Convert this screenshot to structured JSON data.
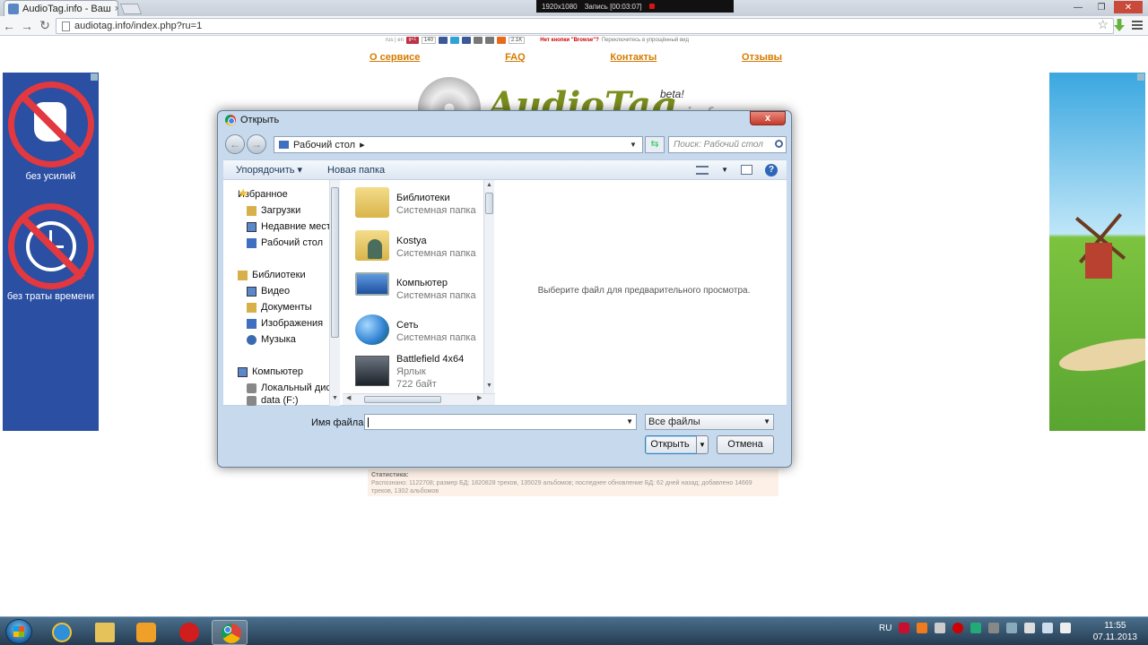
{
  "browser": {
    "tab_title": "AudioTag.info - Ваш",
    "tab_close": "×",
    "url": "audiotag.info/index.php?ru=1",
    "recorder": {
      "resolution": "1920x1080",
      "status": "Запись [00:03:07]"
    }
  },
  "page": {
    "share": {
      "langs": "rus | en",
      "gplus": "g+1",
      "gplus_count": "140",
      "total_count": "2.1K"
    },
    "notice_bold": "Нет кнопки \"Browse\"?",
    "notice_text": "Переключитесь в упрощённый вид",
    "nav": [
      "О сервисе",
      "FAQ",
      "Контакты",
      "Отзывы"
    ],
    "logo": {
      "word": "AudioTag",
      "beta": "beta!",
      "info": ".info"
    },
    "stats_title": "Статистика:",
    "stats_text": "Распознано: 1122708; размер БД: 1820828 треков, 135029 альбомов; последнее обновление БД: 62 дней назад; добавлено 14669 треков, 1302 альбомов",
    "ad_left": {
      "caption1": "без усилий",
      "caption2": "без траты времени"
    }
  },
  "dialog": {
    "title": "Открыть",
    "close_label": "x",
    "location": "Рабочий стол",
    "search_placeholder": "Поиск: Рабочий стол",
    "toolbar": {
      "organize": "Упорядочить ▾",
      "new_folder": "Новая папка"
    },
    "nav_items": [
      {
        "label": "Избранное",
        "icon": "star-icon"
      },
      {
        "label": "Загрузки",
        "icon": "downloads-icon"
      },
      {
        "label": "Недавние места",
        "icon": "recent-places-icon"
      },
      {
        "label": "Рабочий стол",
        "icon": "desktop-icon"
      },
      {
        "label": "Библиотеки",
        "icon": "libraries-icon"
      },
      {
        "label": "Видео",
        "icon": "video-icon"
      },
      {
        "label": "Документы",
        "icon": "documents-icon"
      },
      {
        "label": "Изображения",
        "icon": "pictures-icon"
      },
      {
        "label": "Музыка",
        "icon": "music-icon"
      },
      {
        "label": "Компьютер",
        "icon": "computer-icon"
      },
      {
        "label": "Локальный диск",
        "icon": "local-disk-icon"
      },
      {
        "label": "data (F:)",
        "icon": "drive-icon"
      }
    ],
    "files": [
      {
        "name": "Библиотеки",
        "type": "Системная папка",
        "size": ""
      },
      {
        "name": "Kostya",
        "type": "Системная папка",
        "size": ""
      },
      {
        "name": "Компьютер",
        "type": "Системная папка",
        "size": ""
      },
      {
        "name": "Сеть",
        "type": "Системная папка",
        "size": ""
      },
      {
        "name": "Battlefield 4x64",
        "type": "Ярлык",
        "size": "722 байт"
      }
    ],
    "preview_text": "Выберите файл для предварительного просмотра.",
    "filename_label": "Имя файла:",
    "filename_value": "",
    "filetype": "Все файлы",
    "open_button": "Открыть",
    "cancel_button": "Отмена"
  },
  "taskbar": {
    "lang": "RU",
    "time": "11:55",
    "date": "07.11.2013",
    "pinned": [
      "internet-explorer-icon",
      "explorer-icon",
      "media-player-icon",
      "opera-icon",
      "chrome-icon"
    ]
  },
  "colors": {
    "accent_link": "#d57a00",
    "dialog_frame": "#c6d9ed",
    "taskbar": "#253c52",
    "ad_blue": "#2a4fa3",
    "ad_red": "#e2383f"
  }
}
